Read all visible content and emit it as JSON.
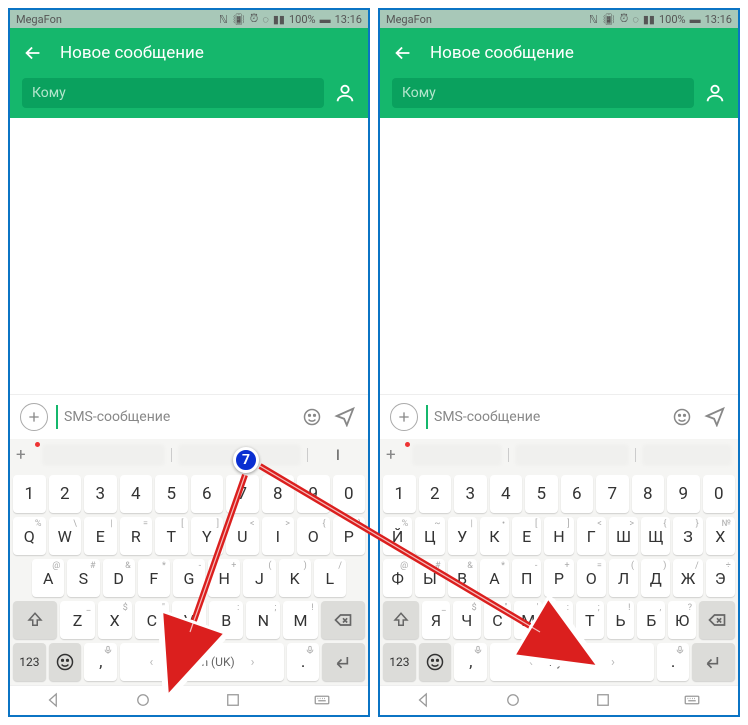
{
  "annotation_badge": "7",
  "screens": [
    {
      "status_carrier": "MegaFon",
      "status_batt": "100%",
      "status_time": "13:16",
      "header_title": "Новое сообщение",
      "to_placeholder": "Кому",
      "sms_placeholder": "SMS-сообщение",
      "sug_text": "I",
      "space_label": "English (UK)",
      "numrow": [
        "1",
        "2",
        "3",
        "4",
        "5",
        "6",
        "7",
        "8",
        "9",
        "0"
      ],
      "row2": [
        {
          "k": "Q",
          "s": "%"
        },
        {
          "k": "W",
          "s": "\\"
        },
        {
          "k": "E",
          "s": "|"
        },
        {
          "k": "R",
          "s": "="
        },
        {
          "k": "T",
          "s": "["
        },
        {
          "k": "Y",
          "s": "]"
        },
        {
          "k": "U",
          "s": "<"
        },
        {
          "k": "I",
          "s": ">"
        },
        {
          "k": "O",
          "s": "{"
        },
        {
          "k": "P",
          "s": "}"
        }
      ],
      "row3": [
        {
          "k": "A",
          "s": "@"
        },
        {
          "k": "S",
          "s": "#"
        },
        {
          "k": "D",
          "s": "&"
        },
        {
          "k": "F",
          "s": "*"
        },
        {
          "k": "G",
          "s": "-"
        },
        {
          "k": "H",
          "s": "+"
        },
        {
          "k": "J",
          "s": "("
        },
        {
          "k": "K",
          "s": ")"
        },
        {
          "k": "L",
          "s": "/"
        }
      ],
      "row4": [
        {
          "k": "Z",
          "s": "_"
        },
        {
          "k": "X",
          "s": "$"
        },
        {
          "k": "C",
          "s": "\""
        },
        {
          "k": "V",
          "s": "'"
        },
        {
          "k": "B",
          "s": ":"
        },
        {
          "k": "N",
          "s": ";"
        },
        {
          "k": "M",
          "s": "!"
        }
      ],
      "key_123": "123"
    },
    {
      "status_carrier": "MegaFon",
      "status_batt": "100%",
      "status_time": "13:16",
      "header_title": "Новое сообщение",
      "to_placeholder": "Кому",
      "sms_placeholder": "SMS-сообщение",
      "sug_text": "",
      "space_label": "Русский",
      "numrow": [
        "1",
        "2",
        "3",
        "4",
        "5",
        "6",
        "7",
        "8",
        "9",
        "0"
      ],
      "row2": [
        {
          "k": "Й",
          "s": "%"
        },
        {
          "k": "Ц",
          "s": "~"
        },
        {
          "k": "У",
          "s": "|"
        },
        {
          "k": "К",
          "s": "•"
        },
        {
          "k": "Е",
          "s": "["
        },
        {
          "k": "Н",
          "s": "]"
        },
        {
          "k": "Г",
          "s": "<"
        },
        {
          "k": "Ш",
          "s": ">"
        },
        {
          "k": "Щ",
          "s": "{"
        },
        {
          "k": "З",
          "s": "}"
        },
        {
          "k": "Х",
          "s": "№"
        }
      ],
      "row3": [
        {
          "k": "Ф",
          "s": "@"
        },
        {
          "k": "Ы",
          "s": "#"
        },
        {
          "k": "В",
          "s": "&"
        },
        {
          "k": "А",
          "s": "*"
        },
        {
          "k": "П",
          "s": "-"
        },
        {
          "k": "Р",
          "s": "+"
        },
        {
          "k": "О",
          "s": "="
        },
        {
          "k": "Л",
          "s": "("
        },
        {
          "k": "Д",
          "s": ")"
        },
        {
          "k": "Ж",
          "s": "/"
        },
        {
          "k": "Э",
          "s": "÷"
        }
      ],
      "row4": [
        {
          "k": "Я",
          "s": "_"
        },
        {
          "k": "Ч",
          "s": "$"
        },
        {
          "k": "С",
          "s": "\""
        },
        {
          "k": "М",
          "s": "'"
        },
        {
          "k": "И",
          "s": ":"
        },
        {
          "k": "Т",
          "s": ";"
        },
        {
          "k": "Ь",
          "s": "!"
        },
        {
          "k": "Б",
          "s": ","
        },
        {
          "k": "Ю",
          "s": "?"
        }
      ],
      "key_123": "123"
    }
  ]
}
